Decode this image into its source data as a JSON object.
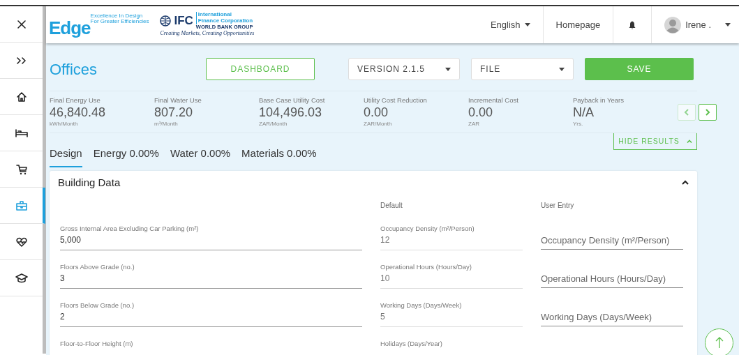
{
  "sidebar": {
    "items": [
      {
        "kind": "close",
        "selected": false
      },
      {
        "kind": "expand",
        "selected": false
      },
      {
        "kind": "home",
        "selected": false
      },
      {
        "kind": "bed",
        "selected": false
      },
      {
        "kind": "cart",
        "selected": false
      },
      {
        "kind": "briefcase",
        "selected": true
      },
      {
        "kind": "heart",
        "selected": false
      },
      {
        "kind": "cap",
        "selected": false
      }
    ]
  },
  "topbar": {
    "logo": {
      "wordmark": "Edge",
      "tagline": [
        "Excellence In Design",
        "For Greater Efficiencies"
      ]
    },
    "ifc": {
      "acronym": "IFC",
      "name": [
        "International",
        "Finance Corporation"
      ],
      "group": "WORLD BANK GROUP",
      "slogan": "Creating Markets, Creating Opportunities"
    },
    "language": "English",
    "homepage": "Homepage",
    "user": "Irene ."
  },
  "page": {
    "title": "Offices",
    "dashboard": "DASHBOARD",
    "version": "VERSION 2.1.5",
    "file": "FILE",
    "save": "SAVE"
  },
  "results": {
    "metrics": [
      {
        "label": "Final Energy Use",
        "value": "46,840.48",
        "unit": "kWh/Month"
      },
      {
        "label": "Final Water Use",
        "value": "807.20",
        "unit": "m³/Month"
      },
      {
        "label": "Base Case Utility Cost",
        "value": "104,496.03",
        "unit": "ZAR/Month"
      },
      {
        "label": "Utility Cost Reduction",
        "value": "0.00",
        "unit": "ZAR/Month"
      },
      {
        "label": "Incremental Cost",
        "value": "0.00",
        "unit": "ZAR"
      },
      {
        "label": "Payback in Years",
        "value": "N/A",
        "unit": "Yrs."
      }
    ],
    "prev": {
      "disabled": true
    },
    "next": {
      "disabled": false
    },
    "hide": "HIDE RESULTS"
  },
  "tabs": [
    {
      "label": "Design",
      "selected": true
    },
    {
      "label": "Energy 0.00%",
      "selected": false
    },
    {
      "label": "Water 0.00%",
      "selected": false
    },
    {
      "label": "Materials 0.00%",
      "selected": false
    }
  ],
  "card": {
    "title": "Building Data",
    "expanded": true,
    "default_heading": "Default",
    "user_heading": "User Entry",
    "rows": [
      {
        "label": "Gross Internal Area Excluding Car Parking (m²)",
        "value": "5,000",
        "default_label": "Occupancy Density (m²/Person)",
        "default_value": "12",
        "user_placeholder": "Occupancy Density (m²/Person)"
      },
      {
        "label": "Floors Above Grade (no.)",
        "value": "3",
        "default_label": "Operational Hours (Hours/Day)",
        "default_value": "10",
        "user_placeholder": "Operational Hours (Hours/Day)"
      },
      {
        "label": "Floors Below Grade (no.)",
        "value": "2",
        "default_label": "Working Days (Days/Week)",
        "default_value": "5",
        "user_placeholder": "Working Days (Days/Week)"
      },
      {
        "label": "Floor-to-Floor Height (m)",
        "default_label": "Holidays (Days/Year)"
      }
    ]
  }
}
